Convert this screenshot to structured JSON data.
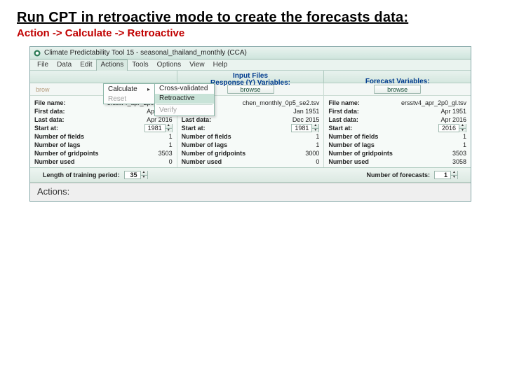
{
  "slide": {
    "title": "Run CPT in retroactive mode to create the forecasts data:",
    "subtitle": "Action -> Calculate -> Retroactive"
  },
  "window": {
    "title": "Climate Predictability Tool 15 - seasonal_thailand_monthly (CCA)"
  },
  "menu": {
    "items": [
      "File",
      "Data",
      "Edit",
      "Actions",
      "Tools",
      "Options",
      "View",
      "Help"
    ],
    "open_index": 3,
    "actions_dropdown": {
      "calculate": "Calculate",
      "reset": "Reset",
      "submenu": {
        "cross_validated": "Cross-validated",
        "retroactive": "Retroactive",
        "verify": "Verify"
      }
    }
  },
  "columns": {
    "x": {
      "header": "",
      "browse_placeholder": "brow",
      "file_name": "ersstv4_apr_2p0_gl.tsv",
      "first_data": "Apr 1951",
      "last_data": "Apr 2016",
      "start_at": "1981",
      "fields_label": "Number of fields",
      "fields_val": "1",
      "lags_label": "Number of lags",
      "lags_val": "1",
      "gp_label": "Number of gridpoints",
      "gp_val": "3503",
      "used_label": "Number used",
      "used_val": "0"
    },
    "y": {
      "header": "Input Files\nResponse (Y) Variables:",
      "browse": "browse",
      "file_name": "chen_monthly_0p5_se2.tsv",
      "first_data": "Jan 1951",
      "last_data": "Dec 2015",
      "start_at": "1981",
      "fields_val": "1",
      "lags_val": "1",
      "gp_val": "3000",
      "used_val": "0"
    },
    "f": {
      "header": "Forecast Variables:",
      "browse": "browse",
      "file_name": "ersstv4_apr_2p0_gl.tsv",
      "first_data": "Apr 1951",
      "last_data": "Apr 2016",
      "start_at": "2016",
      "fields_val": "1",
      "lags_val": "1",
      "gp_val": "3503",
      "used_val": "3058"
    },
    "labels": {
      "file_name": "File name:",
      "first_data": "First data:",
      "last_data": "Last data:",
      "start_at": "Start at:"
    }
  },
  "footer": {
    "length_label": "Length of training period:",
    "length_val": "35",
    "nfore_label": "Number of forecasts:",
    "nfore_val": "1"
  },
  "actions_bar": "Actions:"
}
